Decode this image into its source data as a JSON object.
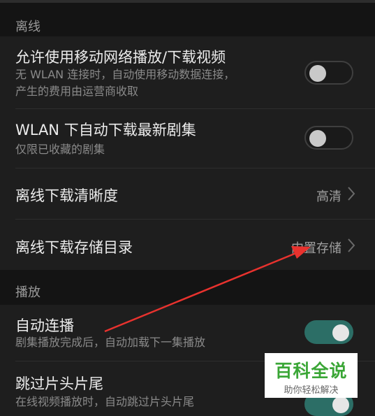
{
  "sections": {
    "offline": {
      "header": "离线",
      "mobile_network": {
        "title": "允许使用移动网络播放/下载视频",
        "desc_line1": "无 WLAN 连接时，自动使用移动数据连接，",
        "desc_line2": "产生的费用由运营商收取",
        "enabled": false
      },
      "wlan_auto_download": {
        "title": "WLAN 下自动下载最新剧集",
        "desc": "仅限已收藏的剧集",
        "enabled": false
      },
      "download_quality": {
        "title": "离线下载清晰度",
        "value": "高清"
      },
      "download_storage": {
        "title": "离线下载存储目录",
        "value": "内置存储"
      }
    },
    "playback": {
      "header": "播放",
      "autoplay": {
        "title": "自动连播",
        "desc": "剧集播放完成后，自动加载下一集播放",
        "enabled": true
      },
      "skip_intro": {
        "title": "跳过片头片尾",
        "desc": "在线视频播放时，自动跳过片头片尾"
      }
    }
  },
  "annotation": {
    "arrow_color": "#e8322e",
    "icon": "arrow-annotation"
  },
  "watermark": {
    "main": "百科全说",
    "sub": "助你轻松解决",
    "color": "#3aa636"
  },
  "colors": {
    "toggle_on": "#2c6e66",
    "background": "#141414",
    "panel": "#1e1e1e"
  }
}
